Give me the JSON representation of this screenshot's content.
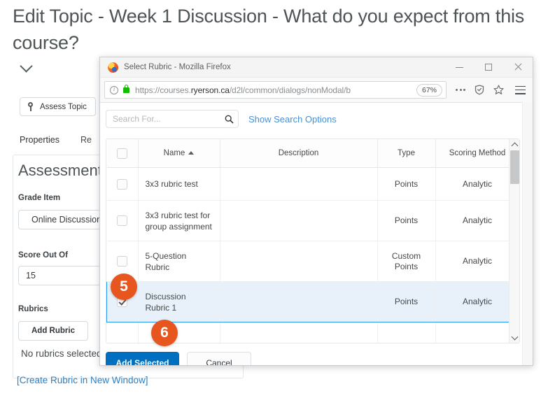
{
  "background_page": {
    "title": "Edit Topic - Week 1 Discussion - What do you expect from this course?",
    "collapse_icon": "chevron-down-icon",
    "assess_topic_button": "Assess Topic",
    "assess_topic_icon": "key-icon",
    "tabs": [
      {
        "label": "Properties",
        "active": true
      },
      {
        "label": "Re",
        "active": false
      }
    ],
    "assessment_heading": "Assessment",
    "grade_item_label": "Grade Item",
    "grade_item_value": "Online Discussion",
    "score_out_of_label": "Score Out Of",
    "score_out_of_value": "15",
    "rubrics_label": "Rubrics",
    "add_rubric_button": "Add Rubric",
    "no_rubrics_text": "No rubrics selected",
    "create_rubric_link": "[Create Rubric in New Window]"
  },
  "firefox_window": {
    "title": "Select Rubric - Mozilla Firefox",
    "favicon": "firefox-logo-icon",
    "minimize_label": "Minimize",
    "maximize_label": "Maximize",
    "close_label": "Close",
    "url_prefix": "https://courses.",
    "url_domain": "ryerson.ca",
    "url_suffix": "/d2l/common/dialogs/nonModal/b",
    "zoom_level": "67%",
    "identity_icon": "info-icon",
    "security_icon": "lock-icon",
    "page_actions_icon": "ellipsis-icon",
    "pocket_icon": "shield-icon",
    "bookmark_icon": "star-icon",
    "menu_icon": "hamburger-menu-icon"
  },
  "dialog": {
    "search": {
      "placeholder": "Search For...",
      "value": "",
      "icon": "search-icon"
    },
    "show_search_options": "Show Search Options",
    "table": {
      "columns": [
        {
          "key": "check",
          "label": ""
        },
        {
          "key": "name",
          "label": "Name",
          "sort": "asc"
        },
        {
          "key": "description",
          "label": "Description"
        },
        {
          "key": "type",
          "label": "Type"
        },
        {
          "key": "scoring",
          "label": "Scoring Method"
        }
      ],
      "rows": [
        {
          "name": "3x3 rubric test",
          "description": "",
          "type": "Points",
          "scoring": "Analytic",
          "selected": false
        },
        {
          "name": "3x3 rubric test for group assignment",
          "description": "",
          "type": "Points",
          "scoring": "Analytic",
          "selected": false
        },
        {
          "name": "5-Question Rubric",
          "description": "",
          "type": "Custom Points",
          "scoring": "Analytic",
          "selected": false
        },
        {
          "name": "Discussion Rubric 1",
          "description": "",
          "type": "Points",
          "scoring": "Analytic",
          "selected": true
        }
      ]
    },
    "buttons": {
      "primary": "Add Selected",
      "secondary": "Cancel"
    }
  },
  "annotations": [
    {
      "number": "5",
      "color": "#e8561f"
    },
    {
      "number": "6",
      "color": "#e8561f"
    }
  ]
}
